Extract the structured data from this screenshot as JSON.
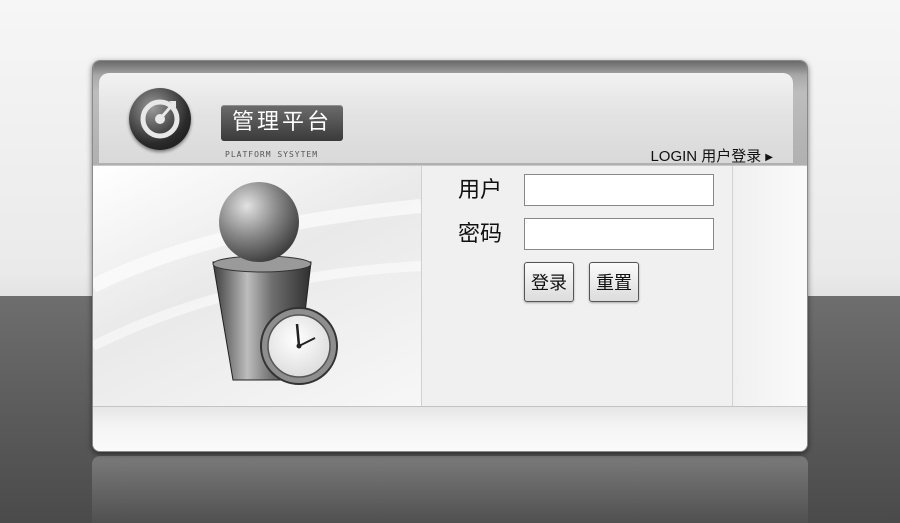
{
  "app": {
    "title": "管理平台",
    "subtitle": "PLATFORM SYSYTEM",
    "login_label": "LOGIN 用户登录"
  },
  "form": {
    "username_label": "用户",
    "username_value": "",
    "password_label": "密码",
    "password_value": "",
    "login_button": "登录",
    "reset_button": "重置"
  },
  "icons": {
    "logo": "target-logo-icon",
    "illustration": "user-clock-icon",
    "arrow": "triangle-right-icon"
  }
}
